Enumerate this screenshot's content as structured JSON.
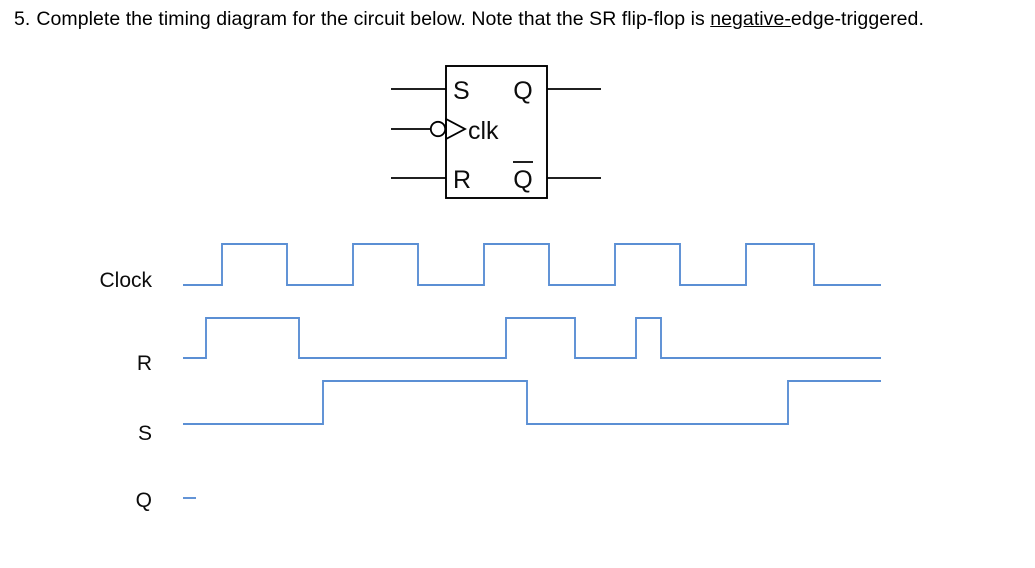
{
  "question": {
    "number": "5.",
    "text_before_underline": "Complete the timing diagram for the circuit below.  Note that the SR flip-flop is ",
    "underlined": "negative-",
    "text_after_underline": "edge-triggered."
  },
  "circuit": {
    "component": "SR flip-flop",
    "inputs": {
      "s_label": "S",
      "clk_label": "clk",
      "r_label": "R"
    },
    "outputs": {
      "q_label": "Q",
      "qbar_label": "Q"
    },
    "clock_edge": "negative",
    "line_color": "#000000"
  },
  "timing": {
    "wave_color": "#5b8fd4",
    "rows": [
      {
        "label": "Clock",
        "name": "clock"
      },
      {
        "label": "R",
        "name": "r"
      },
      {
        "label": "S",
        "name": "s"
      },
      {
        "label": "Q",
        "name": "q"
      }
    ]
  },
  "chart_data": {
    "type": "line",
    "title": "SR flip-flop timing diagram",
    "xlabel": "",
    "ylabel": "",
    "x_range": [
      183,
      881
    ],
    "signals": [
      {
        "name": "Clock",
        "description": "5 full clock pulses, 50% duty cycle, period 131 px, starts low",
        "initial_level": 0,
        "transitions": [
          {
            "x": 222,
            "to": 1
          },
          {
            "x": 287,
            "to": 0
          },
          {
            "x": 353,
            "to": 1
          },
          {
            "x": 418,
            "to": 0
          },
          {
            "x": 484,
            "to": 1
          },
          {
            "x": 549,
            "to": 0
          },
          {
            "x": 615,
            "to": 1
          },
          {
            "x": 680,
            "to": 0
          },
          {
            "x": 746,
            "to": 1
          },
          {
            "x": 814,
            "to": 0
          }
        ],
        "end_level": 0
      },
      {
        "name": "R",
        "description": "three high pulses: wide, wide, narrow",
        "initial_level": 0,
        "transitions": [
          {
            "x": 206,
            "to": 1
          },
          {
            "x": 299,
            "to": 0
          },
          {
            "x": 506,
            "to": 1
          },
          {
            "x": 575,
            "to": 0
          },
          {
            "x": 636,
            "to": 1
          },
          {
            "x": 661,
            "to": 0
          }
        ],
        "end_level": 0
      },
      {
        "name": "S",
        "description": "one wide high pulse then goes high again near the end and stays high",
        "initial_level": 0,
        "transitions": [
          {
            "x": 323,
            "to": 1
          },
          {
            "x": 527,
            "to": 0
          },
          {
            "x": 788,
            "to": 1
          }
        ],
        "end_level": 1
      },
      {
        "name": "Q",
        "description": "blank / to be completed by the student; only a short low stub is drawn",
        "initial_level": 0,
        "transitions": [],
        "end_level": 0,
        "drawn_x_range": [
          183,
          196
        ]
      }
    ]
  }
}
